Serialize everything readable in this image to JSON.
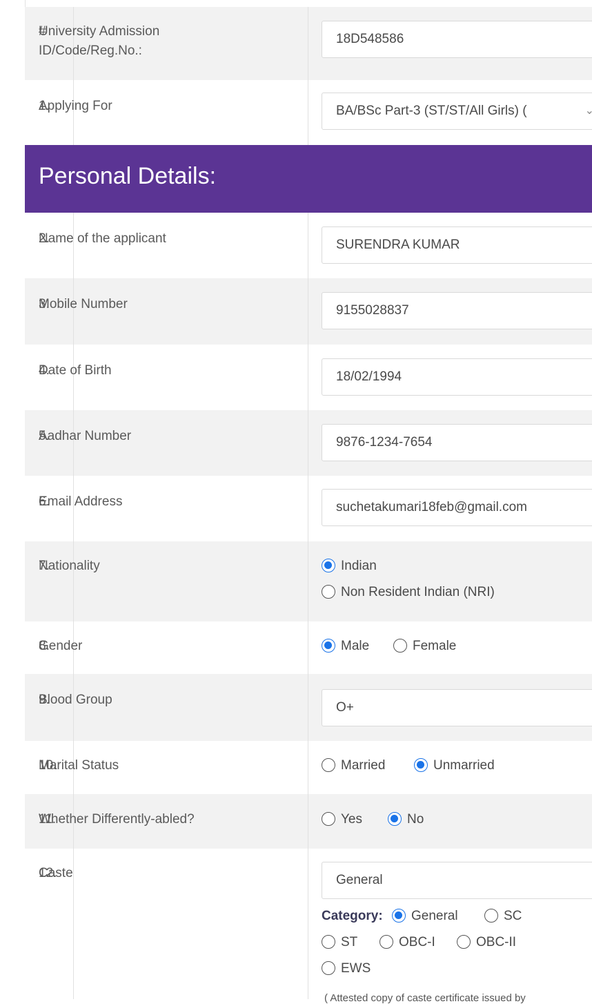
{
  "form": {
    "id_row": {
      "num": "#",
      "label": "University Admission ID/Code/Reg.No.:",
      "value": "18D548586"
    },
    "applying_for": {
      "num": "1.",
      "label": "Applying For",
      "value": "BA/BSc Part-3 (ST/ST/All Girls) ("
    },
    "section_title": "Personal Details:",
    "name": {
      "num": "2.",
      "label": "Name of the applicant",
      "value": "SURENDRA KUMAR"
    },
    "mobile": {
      "num": "3.",
      "label": "Mobile Number",
      "value": "9155028837"
    },
    "dob": {
      "num": "4.",
      "label": "Date of Birth",
      "value": "18/02/1994"
    },
    "aadhar": {
      "num": "5.",
      "label": "Aadhar Number",
      "value": "9876-1234-7654"
    },
    "email": {
      "num": "6.",
      "label": "Email Address",
      "value": "suchetakumari18feb@gmail.com"
    },
    "nationality": {
      "num": "7.",
      "label": "Nationality",
      "options": [
        "Indian",
        "Non Resident Indian (NRI)"
      ],
      "selected": "Indian"
    },
    "gender": {
      "num": "8.",
      "label": "Gender",
      "options": [
        "Male",
        "Female"
      ],
      "selected": "Male"
    },
    "blood_group": {
      "num": "9.",
      "label": "Blood Group",
      "value": "O+"
    },
    "marital": {
      "num": "10.",
      "label": "Marital Status",
      "options": [
        "Married",
        "Unmarried"
      ],
      "selected": "Unmarried"
    },
    "disabled": {
      "num": "11.",
      "label": "Whether Differently-abled?",
      "options": [
        "Yes",
        "No"
      ],
      "selected": "No"
    },
    "caste": {
      "num": "12.",
      "label": "Caste",
      "value": "General",
      "category_label": "Category:",
      "category_options": [
        "General",
        "SC",
        "ST",
        "OBC-I",
        "OBC-II",
        "EWS"
      ],
      "category_selected": "General",
      "note": "( Attested copy of caste certificate issued by"
    }
  },
  "colors": {
    "section_bg": "#5b3494",
    "radio_on": "#1a73e8",
    "row_alt": "#f2f2f2"
  }
}
